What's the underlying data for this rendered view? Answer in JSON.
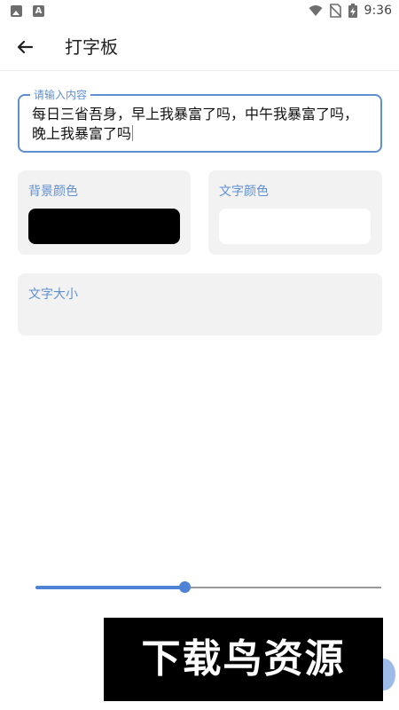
{
  "status_bar": {
    "time": "9:36",
    "notification_icon_letter": "A"
  },
  "app_bar": {
    "title": "打字板",
    "back_icon": "arrow-left-icon"
  },
  "input": {
    "label": "请输入内容",
    "value": "每日三省吾身，早上我暴富了吗，中午我暴富了吗，晚上我暴富了吗"
  },
  "background_color": {
    "label": "背景颜色",
    "value": "#000000"
  },
  "text_color": {
    "label": "文字颜色",
    "value": "#ffffff"
  },
  "text_size": {
    "label": "文字大小",
    "fraction": 0.43
  },
  "accent_color": "#5f8fd0",
  "watermark": {
    "text": "下载鸟资源"
  }
}
